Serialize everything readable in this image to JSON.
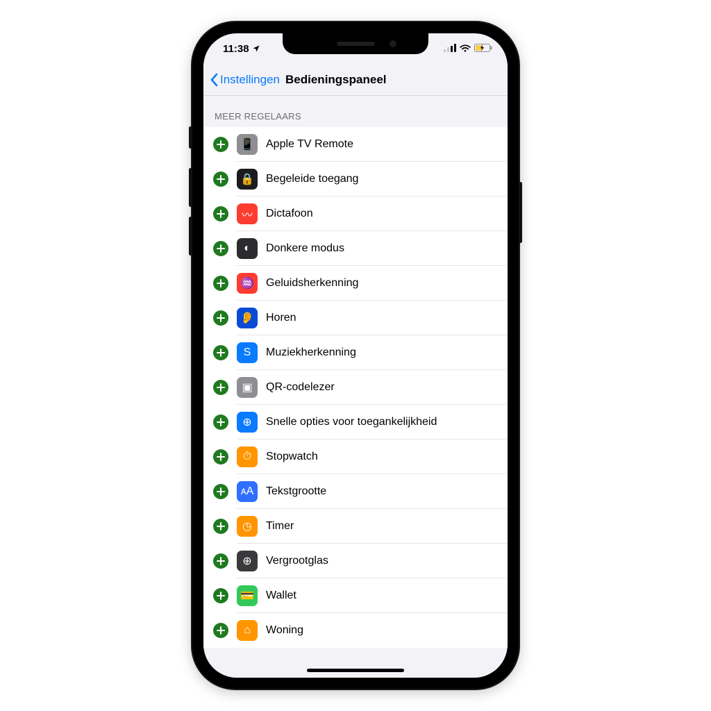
{
  "status": {
    "time": "11:38"
  },
  "nav": {
    "back": "Instellingen",
    "title": "Bedieningspaneel"
  },
  "section": {
    "header": "MEER REGELAARS"
  },
  "items": [
    {
      "id": "apple-tv-remote",
      "label": "Apple TV Remote",
      "iconClass": "ic-gray",
      "glyph": "📱"
    },
    {
      "id": "guided-access",
      "label": "Begeleide toegang",
      "iconClass": "ic-black",
      "glyph": "🔒"
    },
    {
      "id": "voice-memos",
      "label": "Dictafoon",
      "iconClass": "ic-red",
      "glyph": "〰"
    },
    {
      "id": "dark-mode",
      "label": "Donkere modus",
      "iconClass": "ic-dark",
      "glyph": "◐"
    },
    {
      "id": "sound-recog",
      "label": "Geluidsherkenning",
      "iconClass": "ic-red",
      "glyph": "♒"
    },
    {
      "id": "hearing",
      "label": "Horen",
      "iconClass": "ic-navy",
      "glyph": "👂"
    },
    {
      "id": "music-recog",
      "label": "Muziekherkenning",
      "iconClass": "ic-blue",
      "glyph": "S"
    },
    {
      "id": "qr-reader",
      "label": "QR-codelezer",
      "iconClass": "ic-gray",
      "glyph": "▣"
    },
    {
      "id": "accessibility",
      "label": "Snelle opties voor toegankelijkheid",
      "iconClass": "ic-blue",
      "glyph": "⊕"
    },
    {
      "id": "stopwatch",
      "label": "Stopwatch",
      "iconClass": "ic-orange",
      "glyph": "⏱"
    },
    {
      "id": "text-size",
      "label": "Tekstgrootte",
      "iconClass": "ic-blue2",
      "glyph": "ᴀA"
    },
    {
      "id": "timer",
      "label": "Timer",
      "iconClass": "ic-orange",
      "glyph": "◷"
    },
    {
      "id": "magnifier",
      "label": "Vergrootglas",
      "iconClass": "ic-dgray",
      "glyph": "⊕"
    },
    {
      "id": "wallet",
      "label": "Wallet",
      "iconClass": "ic-green",
      "glyph": "💳"
    },
    {
      "id": "home",
      "label": "Woning",
      "iconClass": "ic-orange",
      "glyph": "⌂"
    }
  ]
}
